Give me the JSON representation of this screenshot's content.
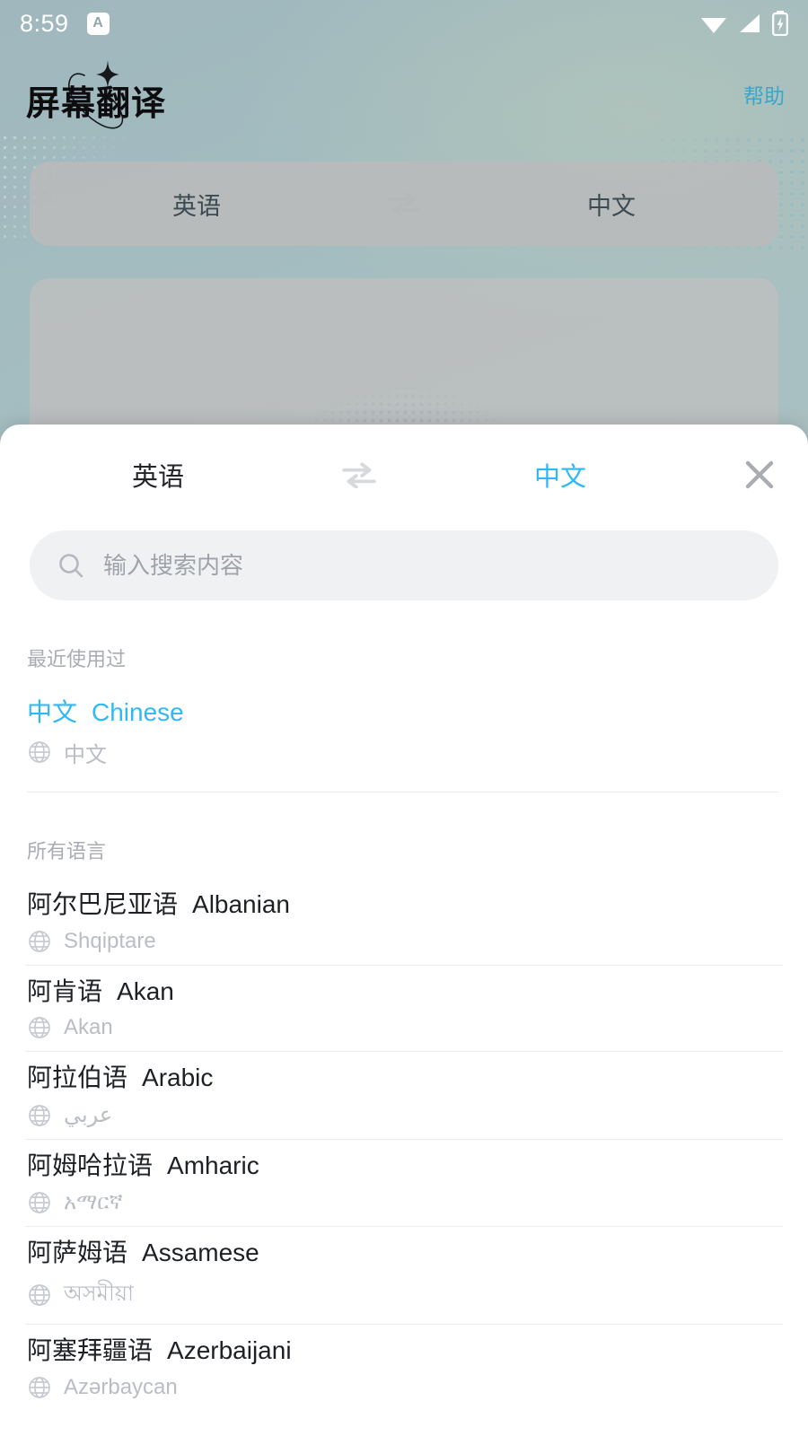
{
  "statusbar": {
    "time": "8:59",
    "silent_badge": "A",
    "icons": [
      "wifi-icon",
      "signal-icon",
      "battery-charging-icon"
    ]
  },
  "header": {
    "app_title": "屏幕翻译",
    "help_label": "帮助"
  },
  "language_bar": {
    "source": "英语",
    "target": "中文",
    "swap_icon": "swap-horizontal-icon"
  },
  "sheet": {
    "source_lang": "英语",
    "target_lang": "中文",
    "swap_icon": "swap-horizontal-icon",
    "close_icon": "close-icon",
    "search": {
      "icon": "search-icon",
      "value": "",
      "placeholder": "输入搜索内容"
    },
    "recent_section_title": "最近使用过",
    "all_section_title": "所有语言",
    "recent": [
      {
        "zh": "中文",
        "en": "Chinese",
        "native": "中文"
      }
    ],
    "all": [
      {
        "zh": "阿尔巴尼亚语",
        "en": "Albanian",
        "native": "Shqiptare"
      },
      {
        "zh": "阿肯语",
        "en": "Akan",
        "native": "Akan"
      },
      {
        "zh": "阿拉伯语",
        "en": "Arabic",
        "native": "عربي"
      },
      {
        "zh": "阿姆哈拉语",
        "en": "Amharic",
        "native": "አማርኛ"
      },
      {
        "zh": "阿萨姆语",
        "en": "Assamese",
        "native": "অসমীয়া"
      },
      {
        "zh": "阿塞拜疆语",
        "en": "Azerbaijani",
        "native": "Azərbaycan"
      }
    ]
  },
  "colors": {
    "accent": "#2eb9f6",
    "help_link": "#3aa6c9",
    "sheet_bg": "#ffffff",
    "muted_text": "#b9bdc4",
    "globe_ball": "#16a9cf"
  }
}
